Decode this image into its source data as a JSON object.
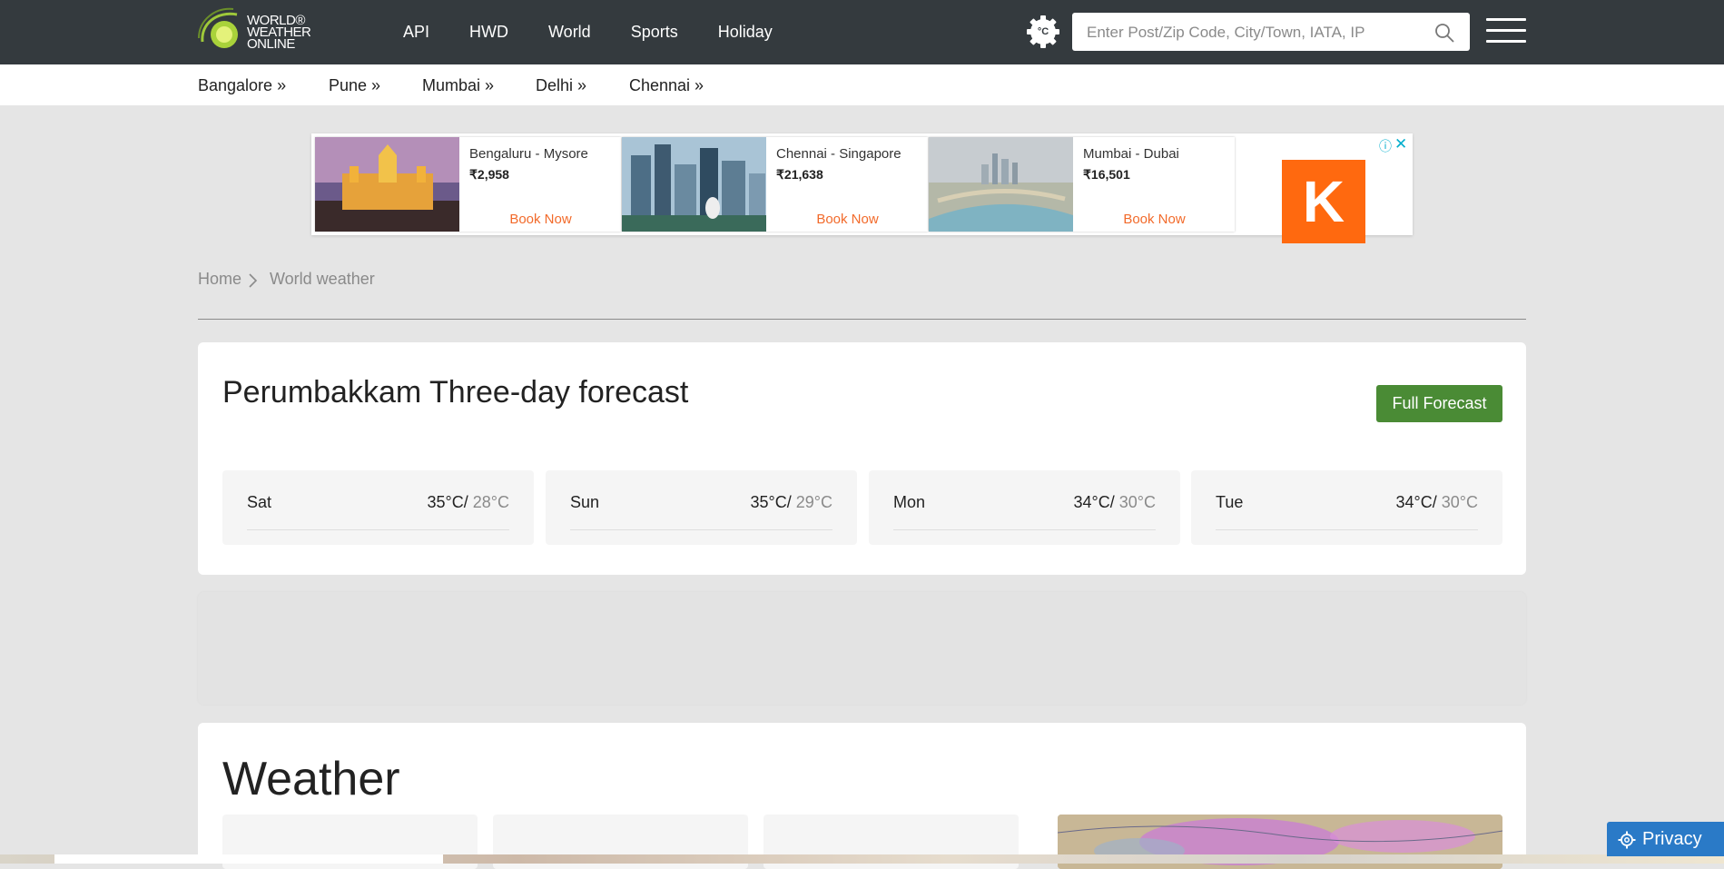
{
  "brand": {
    "logo_lines": [
      "WORLD®",
      "WEATHER",
      "ONLINE"
    ]
  },
  "nav": {
    "items": [
      "API",
      "HWD",
      "World",
      "Sports",
      "Holiday"
    ]
  },
  "unit_toggle": {
    "label": "°C"
  },
  "search": {
    "placeholder": "Enter Post/Zip Code, City/Town, IATA, IP"
  },
  "subnav": {
    "items": [
      "Bangalore »",
      "Pune »",
      "Mumbai »",
      "Delhi »",
      "Chennai »"
    ]
  },
  "ad": {
    "cards": [
      {
        "route": "Bengaluru - Mysore",
        "price": "₹2,958",
        "cta": "Book Now"
      },
      {
        "route": "Chennai - Singapore",
        "price": "₹21,638",
        "cta": "Book Now"
      },
      {
        "route": "Mumbai - Dubai",
        "price": "₹16,501",
        "cta": "Book Now"
      }
    ],
    "brand_letter": "K",
    "info": "ⓘ",
    "close": "✕"
  },
  "breadcrumb": {
    "home": "Home",
    "current": "World weather"
  },
  "forecast": {
    "title": "Perumbakkam Three-day forecast",
    "button": "Full Forecast",
    "days": [
      {
        "day": "Sat",
        "high": "35°C/",
        "low": " 28°C"
      },
      {
        "day": "Sun",
        "high": "35°C/",
        "low": " 29°C"
      },
      {
        "day": "Mon",
        "high": "34°C/",
        "low": " 30°C"
      },
      {
        "day": "Tue",
        "high": "34°C/",
        "low": " 30°C"
      }
    ]
  },
  "weather": {
    "title": "Weather"
  },
  "privacy": {
    "label": "Privacy"
  },
  "colors": {
    "topbar": "#343a3e",
    "accent_green": "#4a8b35",
    "ad_orange": "#f26a2a",
    "privacy_blue": "#2a7ac7"
  }
}
